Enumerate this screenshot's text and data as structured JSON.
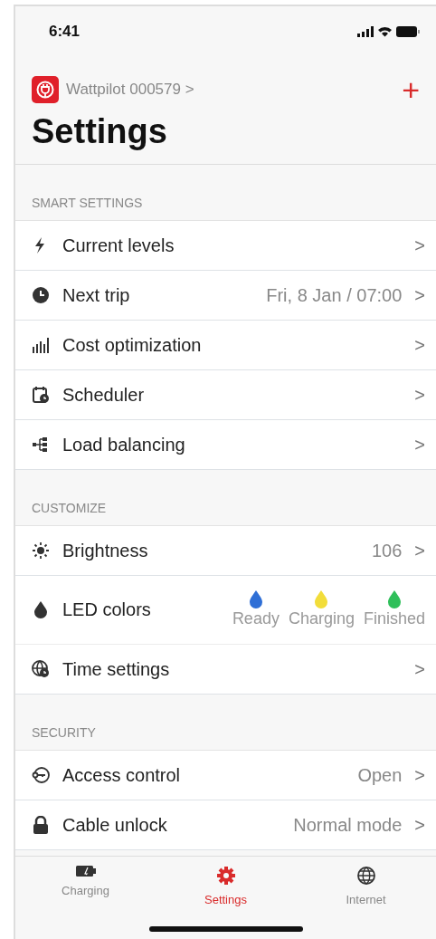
{
  "status_bar": {
    "time": "6:41"
  },
  "device": {
    "name": "Wattpilot 000579",
    "chevron": ">"
  },
  "add_button": {
    "label": "+"
  },
  "title": "Settings",
  "sections": [
    {
      "header": "SMART SETTINGS",
      "rows": [
        {
          "kind": "link",
          "label": "Current levels",
          "value": "",
          "chevron": ">"
        },
        {
          "kind": "link",
          "label": "Next trip",
          "value": "Fri, 8 Jan / 07:00",
          "chevron": ">"
        },
        {
          "kind": "link",
          "label": "Cost optimization",
          "chevron": ">"
        },
        {
          "kind": "link",
          "label": "Scheduler",
          "chevron": ">"
        },
        {
          "kind": "link",
          "label": "Load balancing",
          "chevron": ">"
        }
      ]
    },
    {
      "header": "CUSTOMIZE",
      "rows": [
        {
          "kind": "link",
          "label": "Brightness",
          "value": "106",
          "chevron": ">"
        },
        {
          "kind": "colors",
          "label": "LED colors",
          "colors": [
            {
              "label": "Ready",
              "color": "#2f6fd6"
            },
            {
              "label": "Charging",
              "color": "#f2dd3a"
            },
            {
              "label": "Finished",
              "color": "#2fbf5a"
            }
          ]
        },
        {
          "kind": "link",
          "label": "Time settings",
          "chevron": ">"
        }
      ]
    },
    {
      "header": "SECURITY",
      "rows": [
        {
          "kind": "link",
          "label": "Access control",
          "value": "Open",
          "chevron": ">"
        },
        {
          "kind": "link",
          "label": "Cable unlock",
          "value": "Normal mode",
          "chevron": ">"
        }
      ]
    }
  ],
  "tabs": [
    {
      "label": "Charging",
      "selected": false
    },
    {
      "label": "Settings",
      "selected": true
    },
    {
      "label": "Internet",
      "selected": false
    }
  ]
}
